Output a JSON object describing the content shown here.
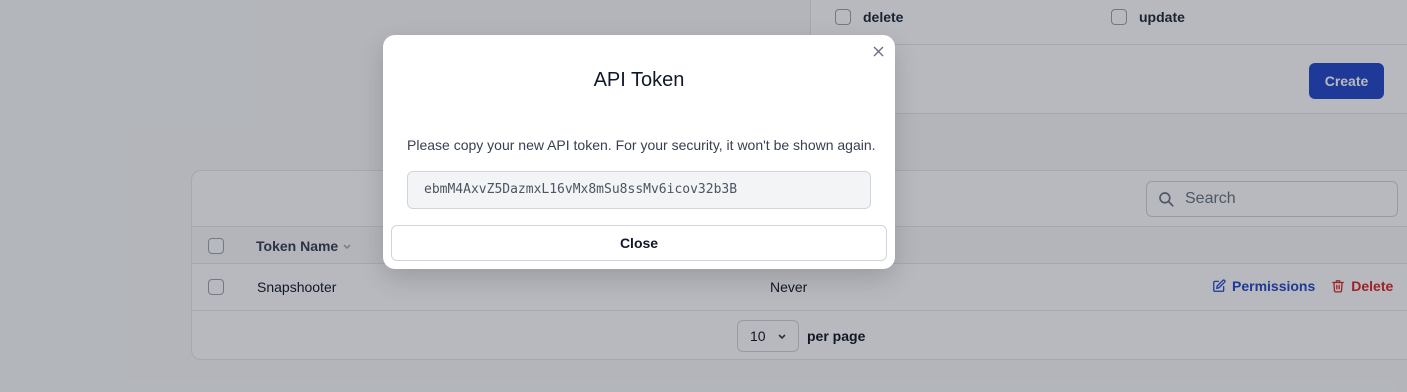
{
  "permissions": {
    "items": [
      {
        "label": "delete"
      },
      {
        "label": "update"
      }
    ],
    "create_label": "Create"
  },
  "tokens_table": {
    "search_placeholder": "Search",
    "columns": {
      "token_name": "Token Name"
    },
    "rows": [
      {
        "name": "Snapshooter",
        "expires": "Never"
      }
    ],
    "actions": {
      "permissions": "Permissions",
      "delete": "Delete"
    },
    "pagination": {
      "per_page_value": "10",
      "per_page_label": "per page"
    }
  },
  "modal": {
    "title": "API Token",
    "message": "Please copy your new API token. For your security, it won't be shown again.",
    "token": "ebmM4AxvZ5DazmxL16vMx8mSu8ssMv6icov32b3B",
    "close_label": "Close"
  },
  "colors": {
    "primary": "#2448c8",
    "danger": "#dc2626",
    "overlay": "rgba(17,24,39,0.30)"
  }
}
